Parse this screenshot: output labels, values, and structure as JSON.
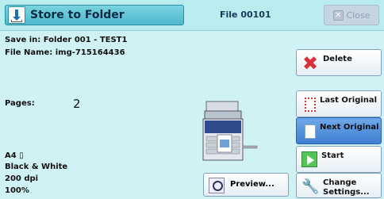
{
  "titlebar": {
    "title": "Store to Folder",
    "file_label": "File 00101",
    "close_label": "Close"
  },
  "info": {
    "save_in": "Save in: Folder 001 - TEST1",
    "file_name": "File Name: img-715164436",
    "pages_label": "Pages:",
    "pages_value": "2",
    "paper_size": "A4 ▯",
    "color_mode": "Black & White",
    "resolution": "200 dpi",
    "zoom": "100%"
  },
  "buttons": {
    "delete": "Delete",
    "last_original": "Last Original",
    "next_original": "Next Original",
    "start": "Start",
    "change_settings_line1": "Change",
    "change_settings_line2": "Settings...",
    "preview": "Preview..."
  }
}
